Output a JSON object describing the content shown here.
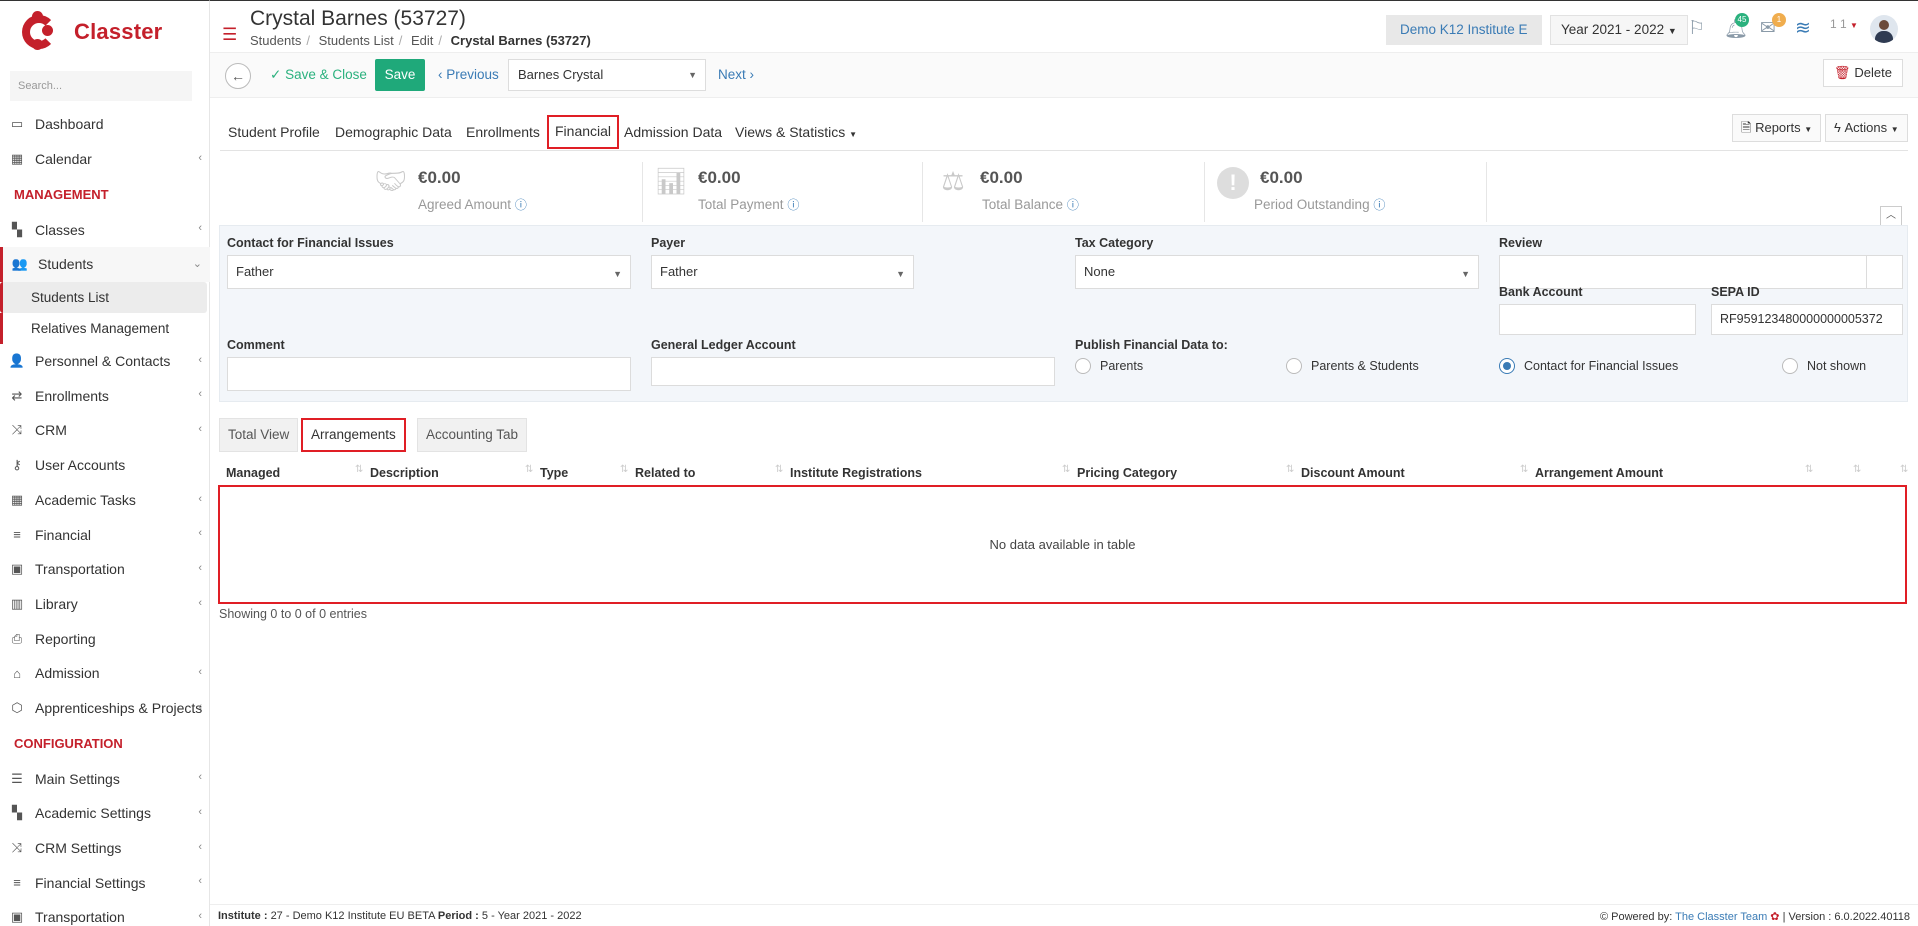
{
  "app": {
    "name": "Classter"
  },
  "sidebar": {
    "search_placeholder": "Search...",
    "items": {
      "dashboard": "Dashboard",
      "calendar": "Calendar",
      "management": "MANAGEMENT",
      "classes": "Classes",
      "students": "Students",
      "students_list": "Students List",
      "relatives": "Relatives Management",
      "personnel": "Personnel & Contacts",
      "enrollments": "Enrollments",
      "crm": "CRM",
      "user_accounts": "User Accounts",
      "academic_tasks": "Academic Tasks",
      "financial": "Financial",
      "transportation": "Transportation",
      "library": "Library",
      "reporting": "Reporting",
      "admission": "Admission",
      "apprenticeships": "Apprenticeships & Projects",
      "configuration": "CONFIGURATION",
      "main_settings": "Main Settings",
      "academic_settings": "Academic Settings",
      "crm_settings": "CRM Settings",
      "financial_settings": "Financial Settings",
      "transportation2": "Transportation"
    }
  },
  "header": {
    "title": "Crystal Barnes (53727)",
    "breadcrumb": [
      "Students",
      "Students List",
      "Edit",
      "Crystal Barnes (53727)"
    ],
    "institute": "Demo K12 Institute E",
    "year": "Year 2021 - 2022",
    "notifications_count": "45",
    "messages_count": "1",
    "user_label": "1 1"
  },
  "toolbar": {
    "save_close": "Save & Close",
    "save": "Save",
    "previous": "Previous",
    "student_select": "Barnes Crystal",
    "next": "Next",
    "delete": "Delete"
  },
  "tabs": {
    "student_profile": "Student Profile",
    "demographic": "Demographic Data",
    "enrollments": "Enrollments",
    "financial": "Financial",
    "admission": "Admission Data",
    "views": "Views & Statistics",
    "reports": "Reports",
    "actions": "Actions"
  },
  "kpis": {
    "agreed": {
      "amount": "€0.00",
      "label": "Agreed Amount"
    },
    "payment": {
      "amount": "€0.00",
      "label": "Total Payment"
    },
    "balance": {
      "amount": "€0.00",
      "label": "Total Balance"
    },
    "outstanding": {
      "amount": "€0.00",
      "label": "Period Outstanding"
    }
  },
  "form": {
    "contact_label": "Contact for Financial Issues",
    "contact_value": "Father",
    "payer_label": "Payer",
    "payer_value": "Father",
    "tax_label": "Tax Category",
    "tax_value": "None",
    "review_label": "Review",
    "review_value": "",
    "bank_label": "Bank Account",
    "bank_value": "",
    "sepa_label": "SEPA ID",
    "sepa_value": "RF959123480000000005372",
    "comment_label": "Comment",
    "comment_value": "",
    "gl_label": "General Ledger Account",
    "gl_value": "",
    "publish_label": "Publish Financial Data to:",
    "publish_options": [
      "Parents",
      "Parents & Students",
      "Contact for Financial Issues",
      "Not shown"
    ],
    "publish_selected": "Contact for Financial Issues"
  },
  "subtabs": {
    "total_view": "Total View",
    "arrangements": "Arrangements",
    "accounting": "Accounting Tab"
  },
  "table": {
    "columns": [
      "Managed",
      "Description",
      "Type",
      "Related to",
      "Institute Registrations",
      "Pricing Category",
      "Discount Amount",
      "Arrangement Amount"
    ],
    "empty": "No data available in table",
    "showing": "Showing 0 to 0 of 0 entries"
  },
  "footer": {
    "institute_label": "Institute :",
    "institute_value": "27 - Demo K12 Institute EU BETA",
    "period_label": "Period :",
    "period_value": "5 - Year 2021 - 2022",
    "powered_by": "Powered by:",
    "team": "The Classter Team",
    "version": "| Version : 6.0.2022.40118"
  },
  "colors": {
    "brand": "#c4202b",
    "accent": "#3a7bb5",
    "save": "#1fa97a",
    "highlight": "#e01e25"
  }
}
